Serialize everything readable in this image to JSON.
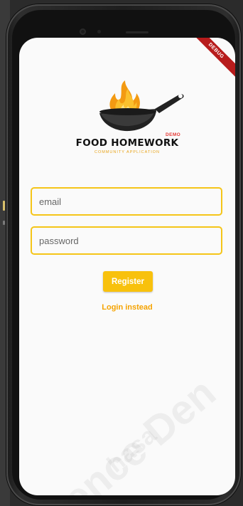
{
  "app": {
    "debug_banner": "DEBUG",
    "brand_title": "FOOD HOMEWORK",
    "brand_badge": "DEMO",
    "brand_subtitle": "COMMUNITY APPLICATION"
  },
  "form": {
    "email_placeholder": "email",
    "password_placeholder": "password",
    "register_label": "Register",
    "login_link_label": "Login instead"
  },
  "icons": {
    "logo": "flaming-frying-pan-icon",
    "camera": "front-camera-icon"
  },
  "colors": {
    "accent": "#f5c518",
    "button": "#f8c10d",
    "link": "#f5a300",
    "debug": "#b71c1c",
    "brand_badge": "#e53935"
  }
}
